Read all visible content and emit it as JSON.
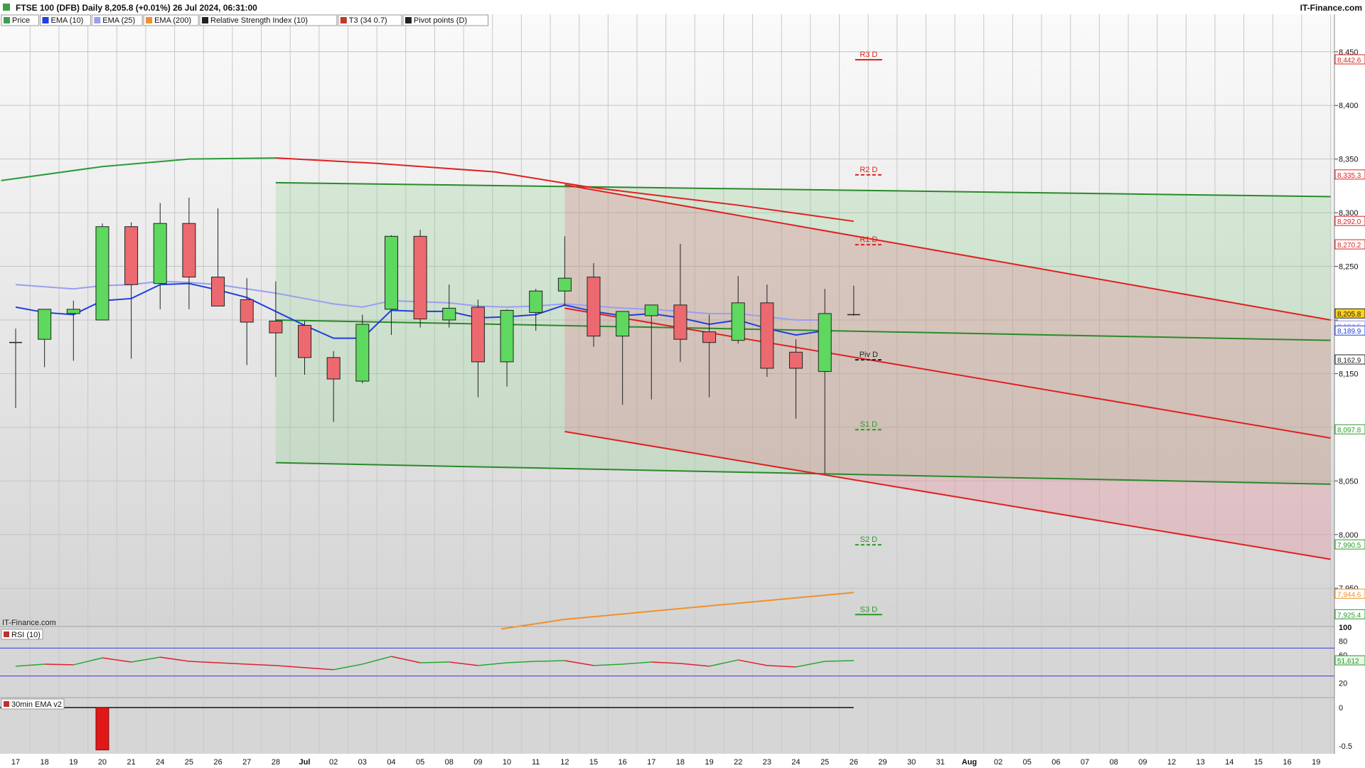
{
  "header": {
    "title": "FTSE 100 (DFB) Daily 8,205.8 (+0.01%) 26 Jul 2024, 06:31:00",
    "brand": "IT-Finance.com"
  },
  "legend": [
    {
      "label": "Price",
      "color": "#3aa04a"
    },
    {
      "label": "EMA (10)",
      "color": "#1f3fe0"
    },
    {
      "label": "EMA (25)",
      "color": "#9a9ef0"
    },
    {
      "label": "EMA (200)",
      "color": "#f0902a"
    },
    {
      "label": "Relative Strength Index (10)",
      "color": "#222222"
    },
    {
      "label": "T3 (34 0.7)",
      "color": "#c0392b"
    },
    {
      "label": "Pivot points (D)",
      "color": "#222222"
    }
  ],
  "watermark": "IT-Finance.com",
  "chart_data": {
    "type": "candlestick",
    "x_tick_labels": [
      "17",
      "18",
      "19",
      "20",
      "21",
      "24",
      "25",
      "26",
      "27",
      "28",
      "Jul",
      "02",
      "03",
      "04",
      "05",
      "08",
      "09",
      "10",
      "11",
      "12",
      "15",
      "16",
      "17",
      "18",
      "19",
      "22",
      "23",
      "24",
      "25",
      "26",
      "29",
      "30",
      "31",
      "Aug",
      "02",
      "05",
      "06",
      "07",
      "08",
      "09",
      "12",
      "13",
      "14",
      "15",
      "16",
      "19"
    ],
    "y_ticks": [
      {
        "v": 7950,
        "label": "7,950"
      },
      {
        "v": 8000,
        "label": "8,000"
      },
      {
        "v": 8050,
        "label": "8,050"
      },
      {
        "v": 8100,
        "label": ""
      },
      {
        "v": 8150,
        "label": "8,150"
      },
      {
        "v": 8200,
        "label": ""
      },
      {
        "v": 8250,
        "label": "8,250"
      },
      {
        "v": 8300,
        "label": "8,300"
      },
      {
        "v": 8350,
        "label": "8,350"
      },
      {
        "v": 8400,
        "label": "8,400"
      },
      {
        "v": 8450,
        "label": "8,450"
      }
    ],
    "ylim": [
      7915,
      8485
    ],
    "candles": [
      {
        "date": "17",
        "open": 8179,
        "high": 8192,
        "low": 8118,
        "close": 8179
      },
      {
        "date": "18",
        "open": 8182,
        "high": 8208,
        "low": 8156,
        "close": 8210
      },
      {
        "date": "19",
        "open": 8206,
        "high": 8218,
        "low": 8162,
        "close": 8210
      },
      {
        "date": "20",
        "open": 8200,
        "high": 8290,
        "low": 8200,
        "close": 8287
      },
      {
        "date": "21",
        "open": 8287,
        "high": 8291,
        "low": 8164,
        "close": 8233
      },
      {
        "date": "24",
        "open": 8234,
        "high": 8309,
        "low": 8210,
        "close": 8290
      },
      {
        "date": "25",
        "open": 8290,
        "high": 8314,
        "low": 8210,
        "close": 8240
      },
      {
        "date": "26",
        "open": 8240,
        "high": 8304,
        "low": 8217,
        "close": 8213
      },
      {
        "date": "27",
        "open": 8219,
        "high": 8239,
        "low": 8158,
        "close": 8198
      },
      {
        "date": "28",
        "open": 8199,
        "high": 8236,
        "low": 8147,
        "close": 8188
      },
      {
        "date": "Jul",
        "open": 8195,
        "high": 8199,
        "low": 8149,
        "close": 8165
      },
      {
        "date": "02",
        "open": 8165,
        "high": 8171,
        "low": 8105,
        "close": 8145
      },
      {
        "date": "03",
        "open": 8143,
        "high": 8205,
        "low": 8141,
        "close": 8196
      },
      {
        "date": "04",
        "open": 8210,
        "high": 8279,
        "low": 8186,
        "close": 8278
      },
      {
        "date": "05",
        "open": 8278,
        "high": 8284,
        "low": 8193,
        "close": 8201
      },
      {
        "date": "08",
        "open": 8200,
        "high": 8233,
        "low": 8193,
        "close": 8211
      },
      {
        "date": "09",
        "open": 8212,
        "high": 8219,
        "low": 8128,
        "close": 8161
      },
      {
        "date": "10",
        "open": 8161,
        "high": 8210,
        "low": 8138,
        "close": 8209
      },
      {
        "date": "11",
        "open": 8207,
        "high": 8229,
        "low": 8190,
        "close": 8227
      },
      {
        "date": "12",
        "open": 8227,
        "high": 8278,
        "low": 8213,
        "close": 8239
      },
      {
        "date": "15",
        "open": 8240,
        "high": 8253,
        "low": 8175,
        "close": 8185
      },
      {
        "date": "16",
        "open": 8185,
        "high": 8207,
        "low": 8121,
        "close": 8208
      },
      {
        "date": "17",
        "open": 8204,
        "high": 8214,
        "low": 8126,
        "close": 8214
      },
      {
        "date": "18",
        "open": 8214,
        "high": 8271,
        "low": 8161,
        "close": 8182
      },
      {
        "date": "19",
        "open": 8189,
        "high": 8205,
        "low": 8128,
        "close": 8179
      },
      {
        "date": "22",
        "open": 8181,
        "high": 8241,
        "low": 8178,
        "close": 8216
      },
      {
        "date": "23",
        "open": 8216,
        "high": 8233,
        "low": 8147,
        "close": 8155
      },
      {
        "date": "24",
        "open": 8170,
        "high": 8182,
        "low": 8108,
        "close": 8155
      },
      {
        "date": "25",
        "open": 8152,
        "high": 8229,
        "low": 8057,
        "close": 8206
      },
      {
        "date": "26",
        "open": 8205,
        "high": 8232,
        "low": 8204,
        "close": 8205
      }
    ],
    "ema10": [
      8212,
      8207,
      8205,
      8218,
      8220,
      8233,
      8234,
      8228,
      8221,
      8208,
      8195,
      8183,
      8183,
      8209,
      8208,
      8208,
      8202,
      8203,
      8205,
      8214,
      8208,
      8204,
      8206,
      8202,
      8196,
      8200,
      8192,
      8186,
      8190
    ],
    "ema25": [
      8233,
      8231,
      8229,
      8232,
      8233,
      8236,
      8235,
      8233,
      8229,
      8225,
      8220,
      8215,
      8212,
      8218,
      8217,
      8216,
      8213,
      8212,
      8213,
      8215,
      8213,
      8211,
      8210,
      8208,
      8206,
      8206,
      8203,
      8200,
      8200
    ],
    "ema200": [
      {
        "i": 16.8,
        "v": 7912
      },
      {
        "i": 19,
        "v": 7921
      },
      {
        "i": 29,
        "v": 7946
      }
    ],
    "upper_curve": [
      {
        "i": -0.5,
        "v": 8330
      },
      {
        "i": 3,
        "v": 8343
      },
      {
        "i": 6,
        "v": 8350
      },
      {
        "i": 9,
        "v": 8351
      }
    ],
    "t3_red_line": [
      {
        "i": 9,
        "v": 8351
      },
      {
        "i": 12.5,
        "v": 8346
      },
      {
        "i": 16.6,
        "v": 8338
      },
      {
        "i": 19.8,
        "v": 8324
      },
      {
        "i": 25,
        "v": 8307
      },
      {
        "i": 29,
        "v": 8292
      }
    ],
    "channel_green": {
      "upper": [
        {
          "i": 9,
          "v": 8328
        },
        {
          "i": 45.5,
          "v": 8315
        }
      ],
      "lower": [
        {
          "i": 9,
          "v": 8067
        },
        {
          "i": 45.5,
          "v": 8047
        }
      ],
      "mid": [
        {
          "i": 9,
          "v": 8200
        },
        {
          "i": 45.5,
          "v": 8181
        }
      ]
    },
    "channel_red": {
      "upper": [
        {
          "i": 19,
          "v": 8326
        },
        {
          "i": 45.5,
          "v": 8200
        }
      ],
      "lower": [
        {
          "i": 19,
          "v": 8096
        },
        {
          "i": 45.5,
          "v": 7977
        }
      ],
      "mid": [
        {
          "i": 19,
          "v": 8211
        },
        {
          "i": 45.5,
          "v": 8090
        }
      ]
    },
    "pivots": [
      {
        "name": "R3 D",
        "value": 8442.6,
        "label": "8,442.6",
        "color": "#e02020"
      },
      {
        "name": "R2 D",
        "value": 8335.3,
        "label": "8,335.3",
        "color": "#e02020"
      },
      {
        "name": "R1 D",
        "value": 8270.2,
        "label": "8,270.2",
        "color": "#e02020"
      },
      {
        "name": "Piv D",
        "value": 8162.9,
        "label": "8,162.9",
        "color": "#222222"
      },
      {
        "name": "S1 D",
        "value": 8097.8,
        "label": "8,097.8",
        "color": "#2a9a2a"
      },
      {
        "name": "S2 D",
        "value": 7990.5,
        "label": "7,990.5",
        "color": "#2a9a2a"
      },
      {
        "name": "S3 D",
        "value": 7925.4,
        "label": "7,925.4",
        "color": "#2a9a2a"
      }
    ],
    "price_tags": [
      {
        "value": 8292.0,
        "label": "8,292.0",
        "color": "#e02020",
        "fill": "#ffffff"
      },
      {
        "value": 8205.8,
        "label": "8,205.8",
        "color": "#222222",
        "fill": "#ffd21a"
      },
      {
        "value": 8194.5,
        "label": "8,194.5",
        "color": "#8a8ee0",
        "fill": "#ffffff"
      },
      {
        "value": 8189.9,
        "label": "8,189.9",
        "color": "#1f3fe0",
        "fill": "#ffffff"
      },
      {
        "value": 7944.6,
        "label": "7,944.6",
        "color": "#f0902a",
        "fill": "#ffffff"
      }
    ],
    "rsi": {
      "title": "RSI (10)",
      "ylim": [
        0,
        100
      ],
      "levels": [
        70,
        30
      ],
      "y_ticks": [
        {
          "v": 100,
          "label": "100"
        },
        {
          "v": 80,
          "label": "80"
        },
        {
          "v": 60,
          "label": "60"
        },
        {
          "v": 20,
          "label": "20"
        }
      ],
      "last_label": "51,612",
      "values": [
        44,
        47,
        46,
        56,
        50,
        57,
        51,
        49,
        47,
        45,
        42,
        39,
        47,
        58,
        49,
        50,
        45,
        49,
        51,
        52,
        45,
        47,
        50,
        48,
        44,
        53,
        45,
        43,
        51,
        52
      ]
    },
    "ema_panel": {
      "title": "30min EMA v2",
      "y_ticks": [
        {
          "v": 0,
          "label": "0"
        },
        {
          "v": -0.5,
          "label": "-0.5"
        }
      ],
      "ylim": [
        -0.6,
        0.12
      ],
      "bar": {
        "index": 3,
        "value": -0.55
      }
    }
  }
}
